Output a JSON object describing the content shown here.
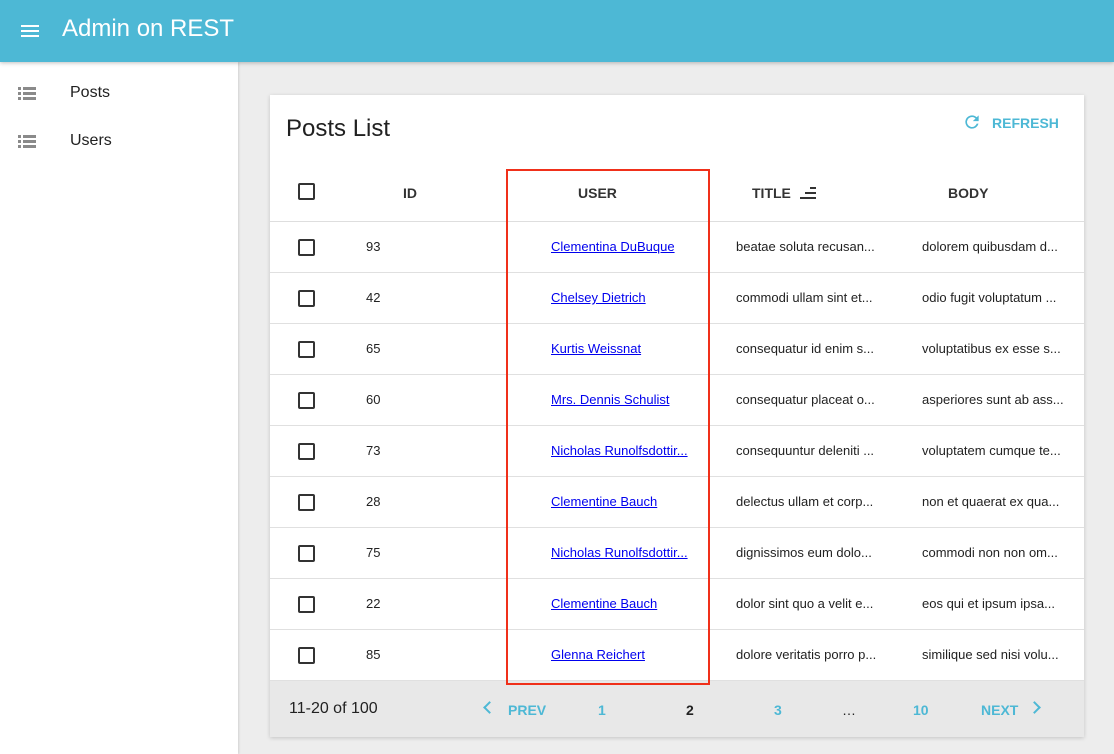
{
  "app": {
    "title": "Admin on REST"
  },
  "sidebar": {
    "items": [
      {
        "label": "Posts"
      },
      {
        "label": "Users"
      }
    ]
  },
  "list": {
    "title": "Posts List",
    "refresh_label": "REFRESH",
    "columns": {
      "id": "ID",
      "user": "USER",
      "title": "TITLE",
      "body": "BODY"
    },
    "rows": [
      {
        "id": "93",
        "user": "Clementina DuBuque",
        "title": "beatae soluta recusan...",
        "body": "dolorem quibusdam d..."
      },
      {
        "id": "42",
        "user": "Chelsey Dietrich",
        "title": "commodi ullam sint et...",
        "body": "odio fugit voluptatum ..."
      },
      {
        "id": "65",
        "user": "Kurtis Weissnat",
        "title": "consequatur id enim s...",
        "body": "voluptatibus ex esse s..."
      },
      {
        "id": "60",
        "user": "Mrs. Dennis Schulist",
        "title": "consequatur placeat o...",
        "body": "asperiores sunt ab ass..."
      },
      {
        "id": "73",
        "user": "Nicholas Runolfsdottir...",
        "title": "consequuntur deleniti ...",
        "body": "voluptatem cumque te..."
      },
      {
        "id": "28",
        "user": "Clementine Bauch",
        "title": "delectus ullam et corp...",
        "body": "non et quaerat ex qua..."
      },
      {
        "id": "75",
        "user": "Nicholas Runolfsdottir...",
        "title": "dignissimos eum dolo...",
        "body": "commodi non non om..."
      },
      {
        "id": "22",
        "user": "Clementine Bauch",
        "title": "dolor sint quo a velit e...",
        "body": "eos qui et ipsum ipsa..."
      },
      {
        "id": "85",
        "user": "Glenna Reichert",
        "title": "dolore veritatis porro p...",
        "body": "similique sed nisi volu..."
      }
    ]
  },
  "pagination": {
    "range": "11-20 of 100",
    "prev": "PREV",
    "next": "NEXT",
    "pages": [
      "1",
      "2",
      "3",
      "…",
      "10"
    ],
    "current": "2"
  },
  "colors": {
    "accent": "#4db8d5",
    "highlight": "#f0301a",
    "link": "#0000ee"
  }
}
